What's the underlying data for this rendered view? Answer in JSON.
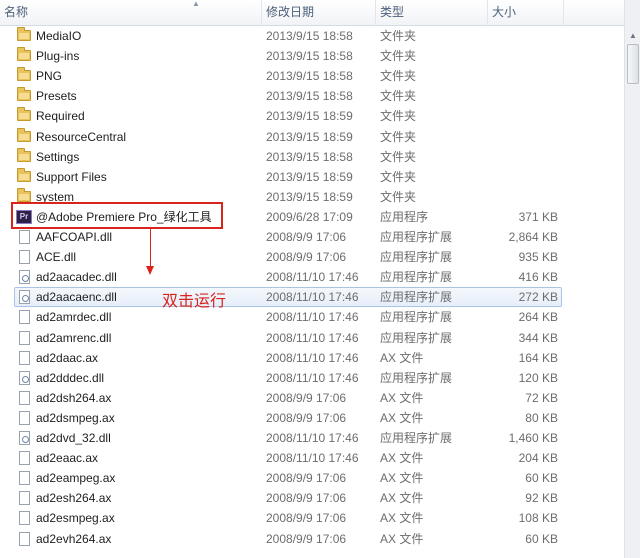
{
  "columns": {
    "name": "名称",
    "date": "修改日期",
    "type": "类型",
    "size": "大小"
  },
  "rows": [
    {
      "icon": "folder-icon",
      "name": "MediaIO",
      "date": "2013/9/15 18:58",
      "type": "文件夹",
      "size": ""
    },
    {
      "icon": "folder-icon",
      "name": "Plug-ins",
      "date": "2013/9/15 18:58",
      "type": "文件夹",
      "size": ""
    },
    {
      "icon": "folder-icon",
      "name": "PNG",
      "date": "2013/9/15 18:58",
      "type": "文件夹",
      "size": ""
    },
    {
      "icon": "folder-icon",
      "name": "Presets",
      "date": "2013/9/15 18:58",
      "type": "文件夹",
      "size": ""
    },
    {
      "icon": "folder-icon",
      "name": "Required",
      "date": "2013/9/15 18:59",
      "type": "文件夹",
      "size": ""
    },
    {
      "icon": "folder-icon",
      "name": "ResourceCentral",
      "date": "2013/9/15 18:59",
      "type": "文件夹",
      "size": ""
    },
    {
      "icon": "folder-icon",
      "name": "Settings",
      "date": "2013/9/15 18:58",
      "type": "文件夹",
      "size": ""
    },
    {
      "icon": "folder-icon",
      "name": "Support Files",
      "date": "2013/9/15 18:59",
      "type": "文件夹",
      "size": ""
    },
    {
      "icon": "folder-icon",
      "name": "system",
      "date": "2013/9/15 18:59",
      "type": "文件夹",
      "size": ""
    },
    {
      "icon": "premiere-app-icon",
      "name": "@Adobe Premiere Pro_绿化工具",
      "date": "2009/6/28 17:09",
      "type": "应用程序",
      "size": "371 KB"
    },
    {
      "icon": "file-icon",
      "name": "AAFCOAPI.dll",
      "date": "2008/9/9 17:06",
      "type": "应用程序扩展",
      "size": "2,864 KB"
    },
    {
      "icon": "file-icon",
      "name": "ACE.dll",
      "date": "2008/9/9 17:06",
      "type": "应用程序扩展",
      "size": "935 KB"
    },
    {
      "icon": "dll-icon",
      "name": "ad2aacadec.dll",
      "date": "2008/11/10 17:46",
      "type": "应用程序扩展",
      "size": "416 KB"
    },
    {
      "icon": "dll-icon",
      "name": "ad2aacaenc.dll",
      "date": "2008/11/10 17:46",
      "type": "应用程序扩展",
      "size": "272 KB"
    },
    {
      "icon": "file-icon",
      "name": "ad2amrdec.dll",
      "date": "2008/11/10 17:46",
      "type": "应用程序扩展",
      "size": "264 KB"
    },
    {
      "icon": "file-icon",
      "name": "ad2amrenc.dll",
      "date": "2008/11/10 17:46",
      "type": "应用程序扩展",
      "size": "344 KB"
    },
    {
      "icon": "file-icon",
      "name": "ad2daac.ax",
      "date": "2008/11/10 17:46",
      "type": "AX 文件",
      "size": "164 KB"
    },
    {
      "icon": "dll-icon",
      "name": "ad2dddec.dll",
      "date": "2008/11/10 17:46",
      "type": "应用程序扩展",
      "size": "120 KB"
    },
    {
      "icon": "file-icon",
      "name": "ad2dsh264.ax",
      "date": "2008/9/9 17:06",
      "type": "AX 文件",
      "size": "72 KB"
    },
    {
      "icon": "file-icon",
      "name": "ad2dsmpeg.ax",
      "date": "2008/9/9 17:06",
      "type": "AX 文件",
      "size": "80 KB"
    },
    {
      "icon": "dll-icon",
      "name": "ad2dvd_32.dll",
      "date": "2008/11/10 17:46",
      "type": "应用程序扩展",
      "size": "1,460 KB"
    },
    {
      "icon": "file-icon",
      "name": "ad2eaac.ax",
      "date": "2008/11/10 17:46",
      "type": "AX 文件",
      "size": "204 KB"
    },
    {
      "icon": "file-icon",
      "name": "ad2eampeg.ax",
      "date": "2008/9/9 17:06",
      "type": "AX 文件",
      "size": "60 KB"
    },
    {
      "icon": "file-icon",
      "name": "ad2esh264.ax",
      "date": "2008/9/9 17:06",
      "type": "AX 文件",
      "size": "92 KB"
    },
    {
      "icon": "file-icon",
      "name": "ad2esmpeg.ax",
      "date": "2008/9/9 17:06",
      "type": "AX 文件",
      "size": "108 KB"
    },
    {
      "icon": "file-icon",
      "name": "ad2evh264.ax",
      "date": "2008/9/9 17:06",
      "type": "AX 文件",
      "size": "60 KB"
    }
  ],
  "selected_index": 13,
  "annotation": {
    "text": "双击运行",
    "color": "#d9231c"
  },
  "colors": {
    "header_text": "#4c607a",
    "meta_text": "#6d6d6d",
    "selection_border": "#a9c4e6",
    "folder": "#e9c25c"
  }
}
